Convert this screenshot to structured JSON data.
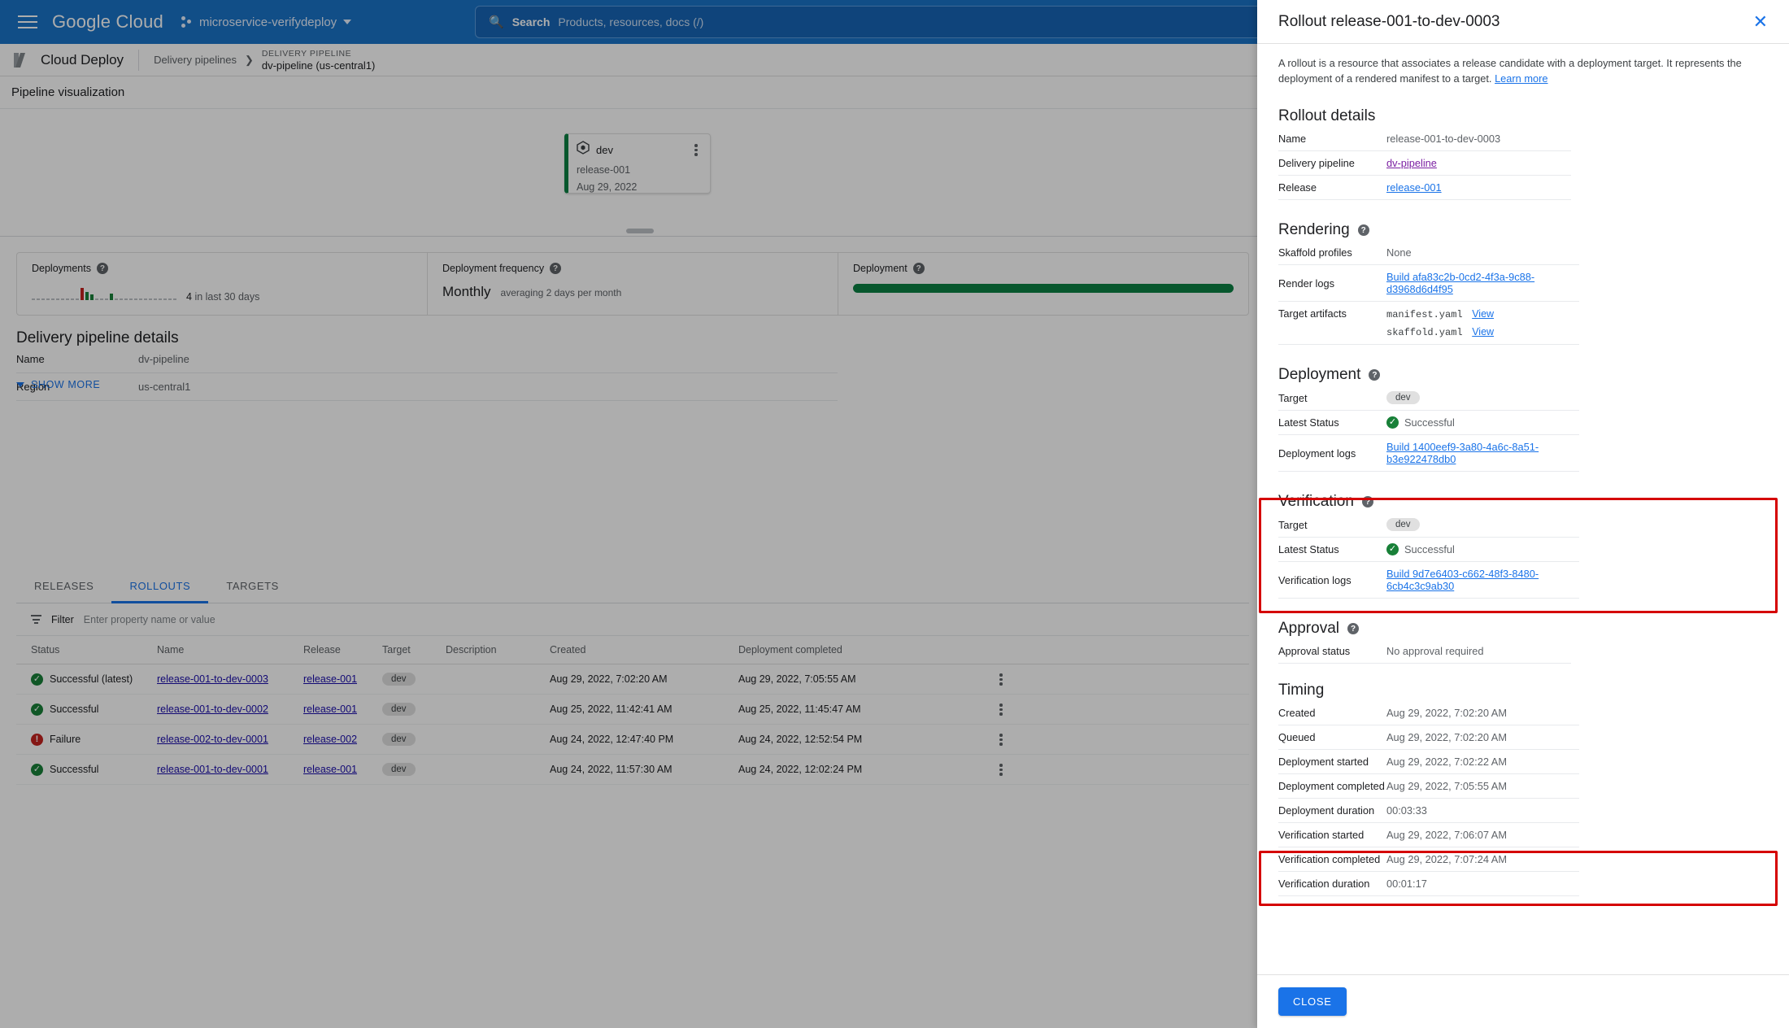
{
  "topbar": {
    "menu_icon": "hamburger-menu-icon",
    "logo_google": "Google",
    "logo_cloud": "Cloud",
    "project_name": "microservice-verifydeploy",
    "search_label": "Search",
    "search_placeholder": "Products, resources, docs (/)"
  },
  "product_bar": {
    "product_title": "Cloud Deploy",
    "breadcrumb_link": "Delivery pipelines",
    "breadcrumb_kicker": "DELIVERY PIPELINE",
    "breadcrumb_current": "dv-pipeline (us-central1)"
  },
  "pipeline_visualization": {
    "header": "Pipeline visualization",
    "target_card": {
      "name": "dev",
      "release": "release-001",
      "date": "Aug 29, 2022"
    }
  },
  "metrics": [
    {
      "title": "Deployments",
      "note_value": "4",
      "note_text": "in last 30 days"
    },
    {
      "title": "Deployment frequency",
      "big": "Monthly",
      "small": "averaging 2 days per month"
    },
    {
      "title": "Deployment"
    }
  ],
  "pipeline_details": {
    "heading": "Delivery pipeline details",
    "rows": [
      {
        "key": "Name",
        "value": "dv-pipeline"
      },
      {
        "key": "Region",
        "value": "us-central1"
      }
    ],
    "show_more": "SHOW MORE"
  },
  "tabs": [
    {
      "label": "RELEASES",
      "active": false
    },
    {
      "label": "ROLLOUTS",
      "active": true
    },
    {
      "label": "TARGETS",
      "active": false
    }
  ],
  "filter": {
    "label": "Filter",
    "placeholder": "Enter property name or value"
  },
  "table": {
    "columns": [
      "Status",
      "Name",
      "Release",
      "Target",
      "Description",
      "Created",
      "Deployment completed"
    ],
    "rows": [
      {
        "status": "Successful (latest)",
        "status_kind": "ok",
        "name": "release-001-to-dev-0003",
        "release": "release-001",
        "target": "dev",
        "description": "",
        "created": "Aug 29, 2022, 7:02:20 AM",
        "deployment_completed": "Aug 29, 2022, 7:05:55 AM"
      },
      {
        "status": "Successful",
        "status_kind": "ok",
        "name": "release-001-to-dev-0002",
        "release": "release-001",
        "target": "dev",
        "description": "",
        "created": "Aug 25, 2022, 11:42:41 AM",
        "deployment_completed": "Aug 25, 2022, 11:45:47 AM"
      },
      {
        "status": "Failure",
        "status_kind": "error",
        "name": "release-002-to-dev-0001",
        "release": "release-002",
        "target": "dev",
        "description": "",
        "created": "Aug 24, 2022, 12:47:40 PM",
        "deployment_completed": "Aug 24, 2022, 12:52:54 PM"
      },
      {
        "status": "Successful",
        "status_kind": "ok",
        "name": "release-001-to-dev-0001",
        "release": "release-001",
        "target": "dev",
        "description": "",
        "created": "Aug 24, 2022, 11:57:30 AM",
        "deployment_completed": "Aug 24, 2022, 12:02:24 PM"
      }
    ]
  },
  "side_panel": {
    "title": "Rollout release-001-to-dev-0003",
    "close_icon": "close-icon",
    "description": "A rollout is a resource that associates a release candidate with a deployment target. It represents the deployment of a rendered manifest to a target.",
    "learn_more": "Learn more",
    "rollout_details": {
      "heading": "Rollout details",
      "name_key": "Name",
      "name_value": "release-001-to-dev-0003",
      "pipeline_key": "Delivery pipeline",
      "pipeline_value": "dv-pipeline",
      "release_key": "Release",
      "release_value": "release-001"
    },
    "rendering": {
      "heading": "Rendering",
      "skaffold_key": "Skaffold profiles",
      "skaffold_value": "None",
      "render_logs_key": "Render logs",
      "render_logs_value": "Build afa83c2b-0cd2-4f3a-9c88-d3968d6d4f95",
      "artifacts_key": "Target artifacts",
      "artifact1": "manifest.yaml",
      "artifact1_link": "View",
      "artifact2": "skaffold.yaml",
      "artifact2_link": "View"
    },
    "deployment": {
      "heading": "Deployment",
      "target_key": "Target",
      "target_value": "dev",
      "status_key": "Latest Status",
      "status_value": "Successful",
      "logs_key": "Deployment logs",
      "logs_value": "Build 1400eef9-3a80-4a6c-8a51-b3e922478db0"
    },
    "verification": {
      "heading": "Verification",
      "target_key": "Target",
      "target_value": "dev",
      "status_key": "Latest Status",
      "status_value": "Successful",
      "logs_key": "Verification logs",
      "logs_value": "Build 9d7e6403-c662-48f3-8480-6cb4c3c9ab30"
    },
    "approval": {
      "heading": "Approval",
      "status_key": "Approval status",
      "status_value": "No approval required"
    },
    "timing": {
      "heading": "Timing",
      "rows": [
        {
          "key": "Created",
          "value": "Aug 29, 2022, 7:02:20 AM"
        },
        {
          "key": "Queued",
          "value": "Aug 29, 2022, 7:02:20 AM"
        },
        {
          "key": "Deployment started",
          "value": "Aug 29, 2022, 7:02:22 AM"
        },
        {
          "key": "Deployment completed",
          "value": "Aug 29, 2022, 7:05:55 AM"
        },
        {
          "key": "Deployment duration",
          "value": "00:03:33"
        },
        {
          "key": "Verification started",
          "value": "Aug 29, 2022, 7:06:07 AM"
        },
        {
          "key": "Verification completed",
          "value": "Aug 29, 2022, 7:07:24 AM"
        },
        {
          "key": "Verification duration",
          "value": "00:01:17"
        }
      ]
    },
    "close_button": "CLOSE"
  },
  "colors": {
    "brand_blue": "#1a73e8",
    "topbar_blue": "#1a73c8",
    "success_green": "#188038",
    "error_red": "#c5221f",
    "highlight_red": "#d50000",
    "target_bar_green": "#0b8043"
  }
}
